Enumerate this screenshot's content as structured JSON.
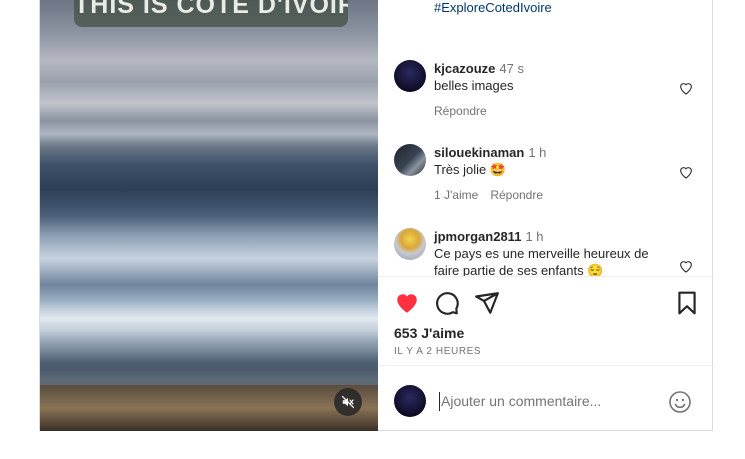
{
  "media": {
    "overlay_text": "THIS IS COTE D'IVOIRE",
    "mute_icon": "volume-muted-icon"
  },
  "caption": {
    "hashtag": "#ExploreCotedIvoire"
  },
  "comments": [
    {
      "username": "kjcazouze",
      "time": "47 s",
      "text": "belles images",
      "reply": "Répondre",
      "likes": ""
    },
    {
      "username": "silouekinaman",
      "time": "1 h",
      "text": "Très jolie 🤩",
      "likes": "1 J'aime",
      "reply": "Répondre"
    },
    {
      "username": "jpmorgan2811",
      "time": "1 h",
      "text": "Ce pays es une merveille heureux de faire partie de ses enfants 😌"
    }
  ],
  "post": {
    "likes": "653 J'aime",
    "time": "IL Y A 2 HEURES",
    "liked": true,
    "like_color": "#ff3040"
  },
  "add_comment": {
    "placeholder": "Ajouter un commentaire..."
  }
}
